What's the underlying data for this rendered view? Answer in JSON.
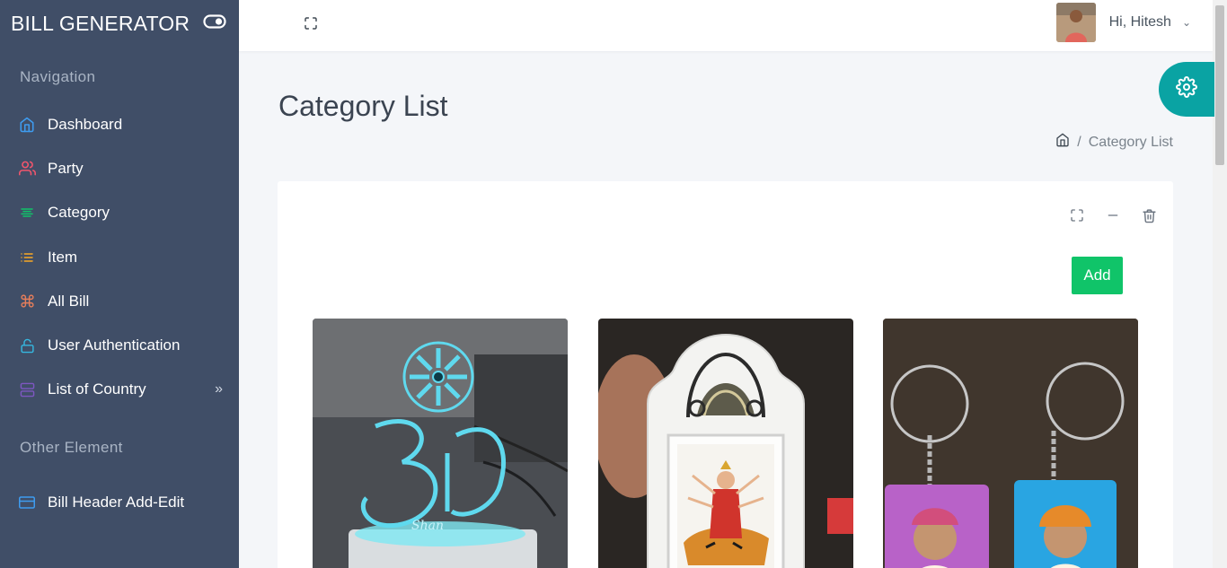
{
  "brand": {
    "title": "BILL GENERATOR"
  },
  "sidebar": {
    "section_navigation": "Navigation",
    "section_other": "Other Element",
    "items": [
      {
        "label": "Dashboard",
        "icon": "home-icon",
        "color": "#3e9cf0"
      },
      {
        "label": "Party",
        "icon": "users-icon",
        "color": "#f1556c"
      },
      {
        "label": "Category",
        "icon": "align-center-icon",
        "color": "#10c469"
      },
      {
        "label": "Item",
        "icon": "list-icon",
        "color": "#f9a825"
      },
      {
        "label": "All Bill",
        "icon": "command-icon",
        "color": "#e67e5b"
      },
      {
        "label": "User Authentication",
        "icon": "unlock-icon",
        "color": "#35b8e0"
      },
      {
        "label": "List of Country",
        "icon": "server-icon",
        "color": "#7e57c2",
        "chevron": "»"
      }
    ],
    "other_items": [
      {
        "label": "Bill Header Add-Edit",
        "icon": "credit-card-icon",
        "color": "#3e9cf0"
      }
    ]
  },
  "topbar": {
    "user_greeting": "Hi, Hitesh",
    "user_chevron": "⌄"
  },
  "page": {
    "title": "Category List",
    "breadcrumb_separator": "/",
    "breadcrumb_current": "Category List"
  },
  "card": {
    "add_label": "Add"
  },
  "colors": {
    "sidebar_bg": "#404e67",
    "accent_teal": "#0aa3a3",
    "add_green": "#10c469"
  }
}
